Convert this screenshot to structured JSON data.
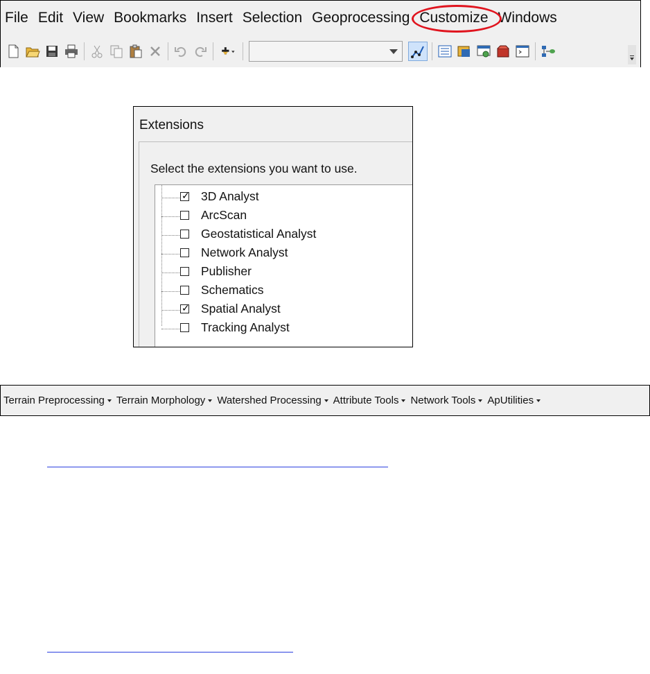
{
  "menubar": {
    "items": [
      "File",
      "Edit",
      "View",
      "Bookmarks",
      "Insert",
      "Selection",
      "Geoprocessing",
      "Customize",
      "Windows"
    ],
    "highlighted_item": "Customize",
    "highlight_color": "#e0141e"
  },
  "toolbar": {
    "buttons": [
      {
        "icon": "new-document-icon"
      },
      {
        "icon": "open-folder-icon"
      },
      {
        "icon": "save-icon"
      },
      {
        "icon": "print-icon"
      },
      {
        "icon": "cut-icon"
      },
      {
        "icon": "copy-icon"
      },
      {
        "icon": "paste-icon"
      },
      {
        "icon": "delete-icon"
      },
      {
        "icon": "undo-icon"
      },
      {
        "icon": "redo-icon"
      },
      {
        "icon": "add-data-icon"
      },
      {
        "icon": "editor-toolbar-icon"
      },
      {
        "icon": "table-of-contents-icon"
      },
      {
        "icon": "catalog-window-icon"
      },
      {
        "icon": "search-window-icon"
      },
      {
        "icon": "arctoolbox-icon"
      },
      {
        "icon": "python-window-icon"
      },
      {
        "icon": "modelbuilder-icon"
      }
    ],
    "scale_value": ""
  },
  "extensions": {
    "title": "Extensions",
    "prompt": "Select the extensions you want to use.",
    "items": [
      {
        "label": "3D Analyst",
        "checked": true
      },
      {
        "label": "ArcScan",
        "checked": false
      },
      {
        "label": "Geostatistical Analyst",
        "checked": false
      },
      {
        "label": "Network Analyst",
        "checked": false
      },
      {
        "label": "Publisher",
        "checked": false
      },
      {
        "label": "Schematics",
        "checked": false
      },
      {
        "label": "Spatial Analyst",
        "checked": true
      },
      {
        "label": "Tracking Analyst",
        "checked": false
      }
    ]
  },
  "hydro_toolbar": {
    "items": [
      "Terrain Preprocessing",
      "Terrain Morphology",
      "Watershed Processing",
      "Attribute Tools",
      "Network Tools",
      "ApUtilities"
    ]
  },
  "link_color": "#2a3fe0"
}
